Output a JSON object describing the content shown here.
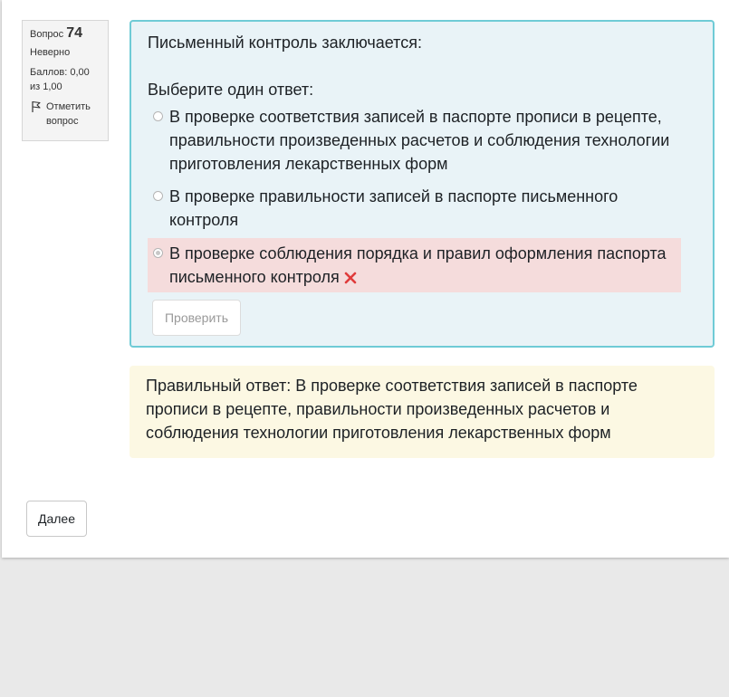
{
  "info": {
    "question_label": "Вопрос",
    "question_number": "74",
    "state": "Неверно",
    "grade": "Баллов: 0,00 из 1,00",
    "flag_label": "Отметить вопрос"
  },
  "question": {
    "text": "Письменный контроль заключается:",
    "prompt": "Выберите один ответ:",
    "answers": [
      {
        "label": "В проверке соответствия записей в паспорте прописи в рецепте, правильности произведенных расчетов и соблюдения технологии приготовления лекарственных форм",
        "selected": false
      },
      {
        "label": "В проверке правильности записей в паспорте письменного контроля",
        "selected": false
      },
      {
        "label": "В проверке соблюдения порядка и правил оформления паспорта письменного контроля",
        "selected": true,
        "status": "incorrect"
      }
    ],
    "check_button": "Проверить"
  },
  "feedback": {
    "right_answer": "Правильный ответ: В проверке соответствия записей в паспорте прописи в рецепте, правильности произведенных расчетов и соблюдения технологии приготовления лекарственных форм"
  },
  "nav": {
    "next_button": "Далее"
  },
  "colors": {
    "formulation_bg": "#e9f3f7",
    "formulation_border": "#6fcbd6",
    "incorrect_bg": "#f5dcdc",
    "feedback_bg": "#fcf8e3",
    "wrong_icon": "#e03b3b"
  }
}
